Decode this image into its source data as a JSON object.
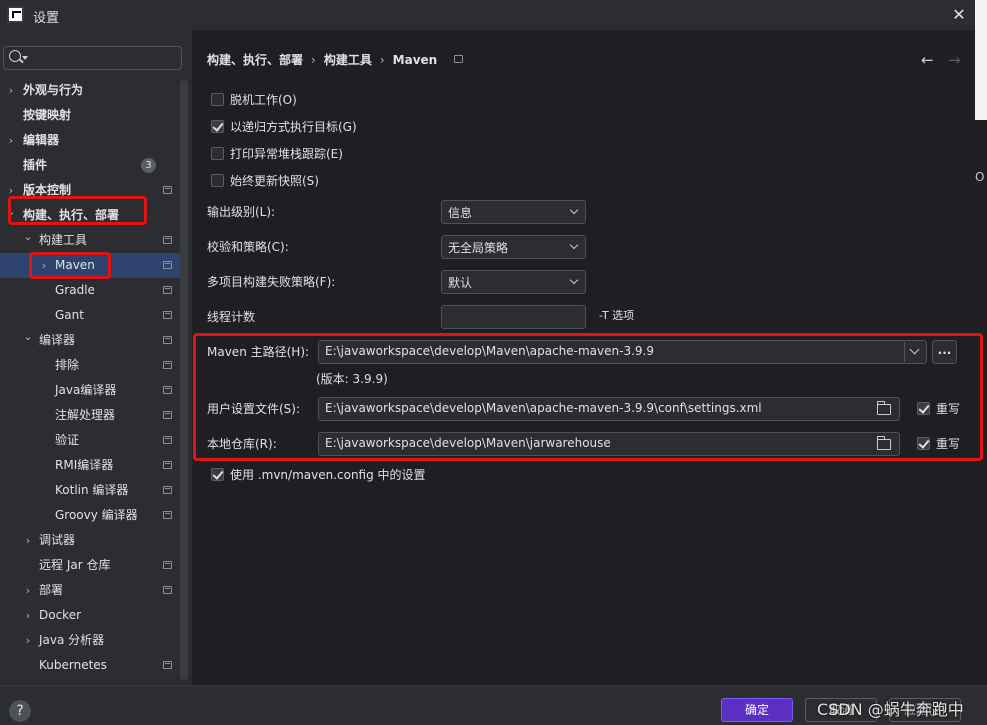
{
  "window": {
    "title": "设置",
    "close_glyph": "✕"
  },
  "background_window": {
    "glyph": "O"
  },
  "sidebar": {
    "search": {
      "value": "",
      "placeholder": ""
    },
    "items": [
      {
        "label": "外观与行为",
        "arrow": "›",
        "bold": true
      },
      {
        "label": "按键映射",
        "bold": true
      },
      {
        "label": "编辑器",
        "arrow": "›",
        "bold": true
      },
      {
        "label": "插件",
        "bold": true,
        "badge": "3"
      },
      {
        "label": "版本控制",
        "arrow": "›",
        "bold": true
      },
      {
        "label": "构建、执行、部署",
        "arrow": "⌄",
        "bold": true
      },
      {
        "label": "构建工具",
        "arrow": "⌄"
      },
      {
        "label": "Maven",
        "arrow": "›"
      },
      {
        "label": "Gradle"
      },
      {
        "label": "Gant"
      },
      {
        "label": "编译器",
        "arrow": "⌄"
      },
      {
        "label": "排除"
      },
      {
        "label": "Java编译器"
      },
      {
        "label": "注解处理器"
      },
      {
        "label": "验证"
      },
      {
        "label": "RMI编译器"
      },
      {
        "label": "Kotlin 编译器"
      },
      {
        "label": "Groovy 编译器"
      },
      {
        "label": "调试器",
        "arrow": "›"
      },
      {
        "label": "远程 Jar 仓库"
      },
      {
        "label": "部署",
        "arrow": "›"
      },
      {
        "label": "Docker",
        "arrow": "›"
      },
      {
        "label": "Java 分析器",
        "arrow": "›"
      },
      {
        "label": "Kubernetes"
      }
    ]
  },
  "breadcrumb": {
    "items": [
      "构建、执行、部署",
      "构建工具",
      "Maven"
    ],
    "separator": "›"
  },
  "nav": {
    "back": "←",
    "forward": "→"
  },
  "options": {
    "offline": {
      "label": "脱机工作(O)",
      "checked": false
    },
    "recursive": {
      "label": "以递归方式执行目标(G)",
      "checked": true
    },
    "print_stack": {
      "label": "打印异常堆栈跟踪(E)",
      "checked": false
    },
    "always_update": {
      "label": "始终更新快照(S)",
      "checked": false
    }
  },
  "fields": {
    "output_level": {
      "label": "输出级别(L):",
      "value": "信息"
    },
    "checksum": {
      "label": "校验和策略(C):",
      "value": "无全局策略"
    },
    "multiproject": {
      "label": "多项目构建失败策略(F):",
      "value": "默认"
    },
    "threads": {
      "label": "线程计数",
      "value": "",
      "hint": "-T 选项"
    },
    "maven_home": {
      "label": "Maven 主路径(H):",
      "value": "E:\\javaworkspace\\develop\\Maven\\apache-maven-3.9.9",
      "browse": "...",
      "version": "(版本: 3.9.9)"
    },
    "user_settings": {
      "label": "用户设置文件(S):",
      "value": "E:\\javaworkspace\\develop\\Maven\\apache-maven-3.9.9\\conf\\settings.xml",
      "override_label": "重写",
      "override": true
    },
    "local_repo": {
      "label": "本地仓库(R):",
      "value": "E:\\javaworkspace\\develop\\Maven\\jarwarehouse",
      "override_label": "重写",
      "override": true
    }
  },
  "use_mvn_config": {
    "label": "使用 .mvn/maven.config 中的设置",
    "checked": true
  },
  "footer": {
    "help": "?",
    "ok": "确定",
    "cancel": "取消",
    "apply": "应用(A)",
    "watermark": "CSDN @蜗牛奔跑中"
  }
}
